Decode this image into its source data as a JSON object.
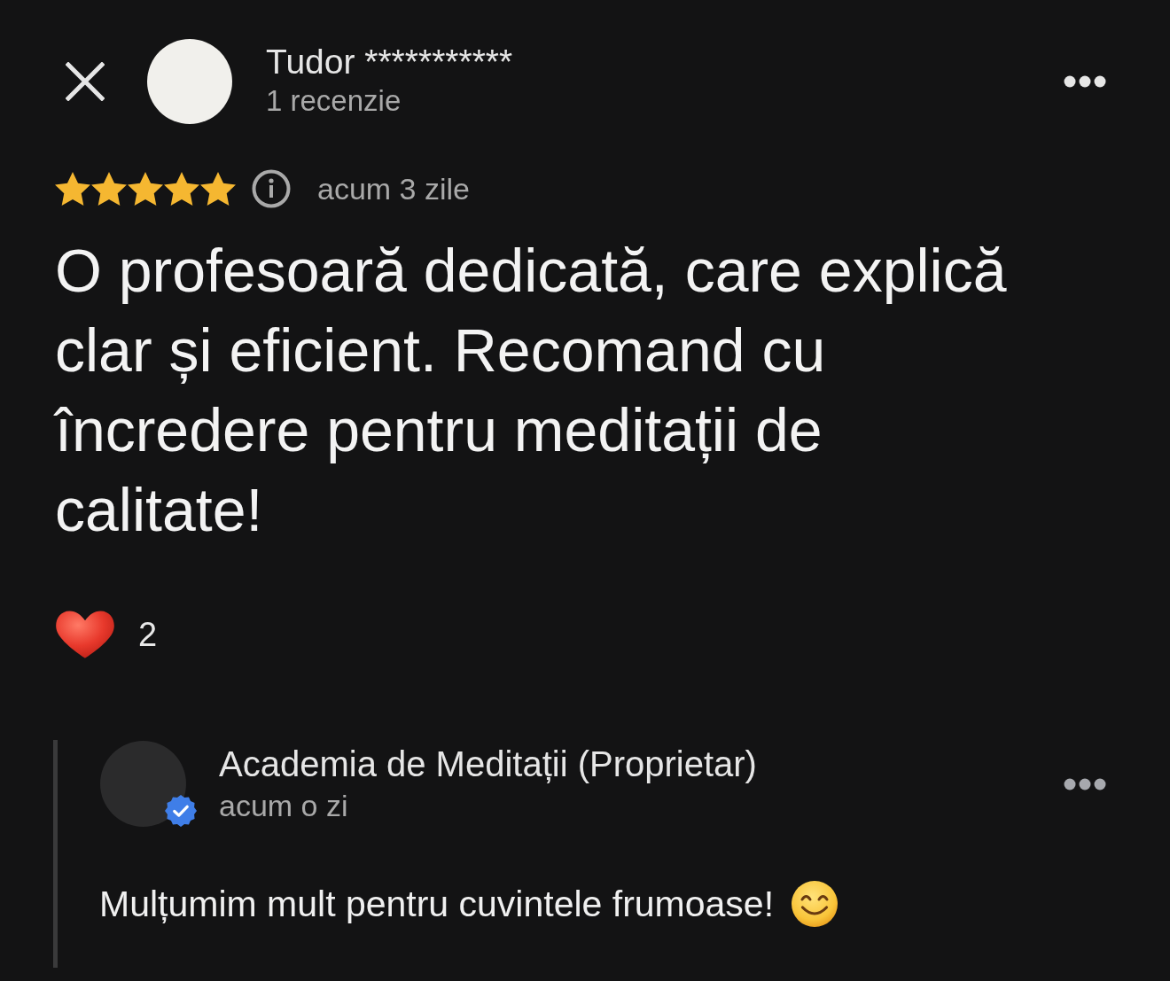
{
  "reviewer": {
    "name": "Tudor ***********",
    "review_count": "1 recenzie"
  },
  "review": {
    "stars": 5,
    "time": "acum 3 zile",
    "text": "O profesoară dedicată, care explică clar și eficient. Recomand cu încredere pentru meditații de calitate!"
  },
  "reactions": [
    {
      "kind": "heart",
      "count": "2"
    }
  ],
  "owner_reply": {
    "name": "Academia de Meditații (Proprietar)",
    "verified": true,
    "time": "acum o zi",
    "text": "Mulțumim mult pentru cuvintele frumoase!"
  }
}
